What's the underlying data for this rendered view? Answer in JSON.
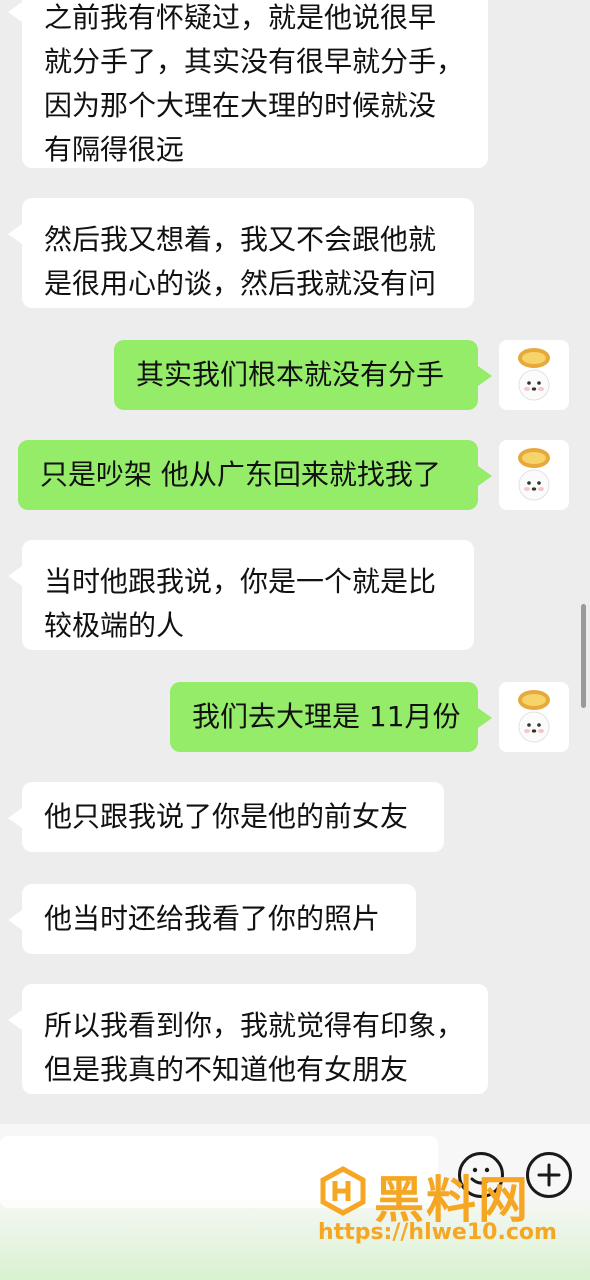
{
  "messages": [
    {
      "side": "left",
      "lines": [
        "之前我有怀疑过，就是他说很早",
        "就分手了，其实没有很早就分手，",
        "因为那个大理在大理的时候就没",
        "有隔得很远"
      ]
    },
    {
      "side": "left",
      "lines": [
        "然后我又想着，我又不会跟他就",
        "是很用心的谈，然后我就没有问"
      ]
    },
    {
      "side": "right",
      "lines": [
        "其实我们根本就没有分手"
      ]
    },
    {
      "side": "right",
      "lines": [
        "只是吵架 他从广东回来就找我了"
      ]
    },
    {
      "side": "left",
      "lines": [
        "当时他跟我说，你是一个就是比",
        "较极端的人"
      ]
    },
    {
      "side": "right",
      "lines": [
        "我们去大理是 11月份"
      ]
    },
    {
      "side": "left",
      "lines": [
        "他只跟我说了你是他的前女友"
      ]
    },
    {
      "side": "left",
      "lines": [
        "他当时还给我看了你的照片"
      ]
    },
    {
      "side": "left",
      "lines": [
        "所以我看到你，我就觉得有印象，",
        "但是我真的不知道他有女朋友"
      ]
    }
  ],
  "input": {
    "value": "",
    "placeholder": ""
  },
  "icons": {
    "avatar": "dog-with-egg-tart-avatar-icon",
    "emoji": "emoji-icon",
    "add": "plus-circle-icon"
  },
  "watermark": {
    "logo_text": "黑料网",
    "url": "https://hlwe10.com"
  },
  "colors": {
    "background": "#ededed",
    "bubble_left": "#ffffff",
    "bubble_right": "#95ec69",
    "watermark": "#f5a623"
  }
}
